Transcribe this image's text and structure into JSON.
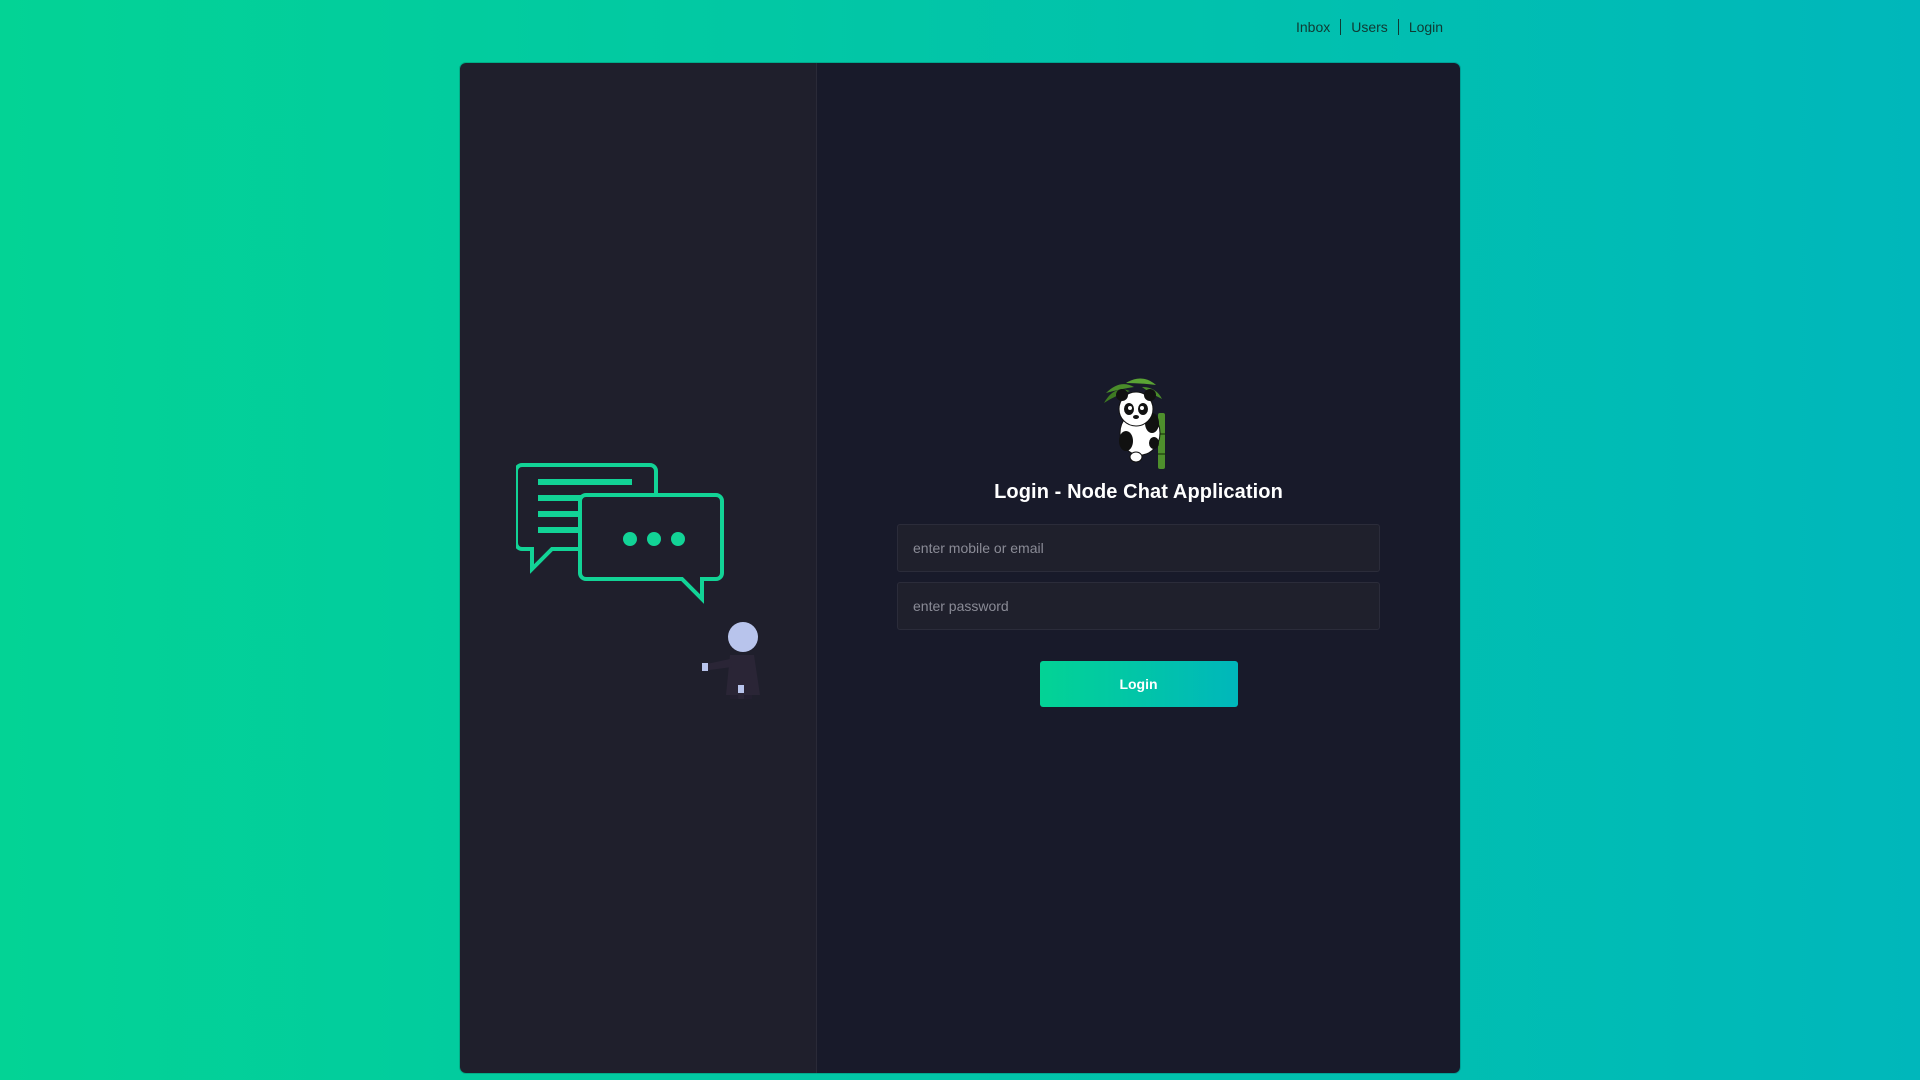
{
  "nav": {
    "items": [
      {
        "label": "Inbox"
      },
      {
        "label": "Users"
      },
      {
        "label": "Login"
      }
    ]
  },
  "login": {
    "title": "Login - Node Chat Application",
    "email_placeholder": "enter mobile or email",
    "email_value": "",
    "password_placeholder": "enter password",
    "password_value": "",
    "button_label": "Login"
  },
  "icons": {
    "logo": "panda-logo-icon",
    "illustration": "chat-bubbles-person-illustration"
  },
  "colors": {
    "accent_start": "#03d395",
    "accent_end": "#00b7bb",
    "left_pane": "#1f1f2c",
    "right_pane": "#181a2a",
    "illustration_stroke": "#12d396"
  }
}
